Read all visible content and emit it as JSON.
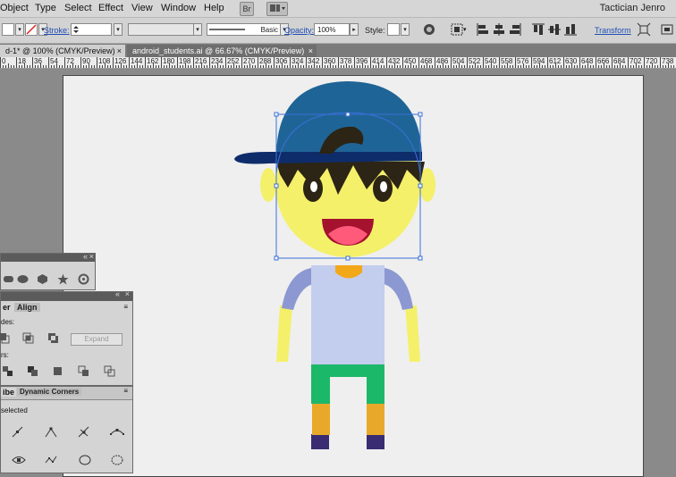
{
  "menubar": {
    "items": [
      "Object",
      "Type",
      "Select",
      "Effect",
      "View",
      "Window",
      "Help"
    ],
    "bridge_label": "Br",
    "user": "Tactician Jenro"
  },
  "controlbar": {
    "stroke_label": "Stroke:",
    "brush_style": "Basic",
    "opacity_label": "Opacity:",
    "opacity_value": "100%",
    "style_label": "Style:",
    "transform_label": "Transform"
  },
  "tabs": [
    {
      "label": "d-1* @ 100% (CMYK/Preview)",
      "active": true
    },
    {
      "label": "android_students.ai @ 66.67% (CMYK/Preview)",
      "active": false
    }
  ],
  "tab_close_glyph": "×",
  "ruler": {
    "labels": [
      "0",
      "18",
      "36",
      "54",
      "72",
      "90",
      "108",
      "126",
      "144",
      "162",
      "180",
      "198",
      "216",
      "234",
      "252",
      "270",
      "288",
      "306",
      "324",
      "342",
      "360",
      "378",
      "396",
      "414",
      "432",
      "450",
      "468",
      "486",
      "504",
      "522",
      "540",
      "558",
      "576",
      "594",
      "612",
      "630",
      "648",
      "666",
      "684",
      "702",
      "720",
      "738"
    ]
  },
  "pathfinder_panel": {
    "tabs": [
      "er",
      "Align"
    ],
    "shape_modes_label": "des:",
    "expand_label": "Expand",
    "pathfinders_label": "rs:"
  },
  "corner_panel": {
    "tabs": [
      "ibe",
      "Dynamic Corners"
    ],
    "selected_label": "selected"
  },
  "colors": {
    "cap": "#1f6496",
    "visor": "#0f2c6a",
    "hair": "#2c2414",
    "skin": "#f4f06a",
    "mouth": "#a4122e",
    "tongue": "#ff5a7a",
    "neck": "#f2a818",
    "shirt": "#c3cdee",
    "sleeve": "#8c98d2",
    "pants": "#1cb86a",
    "sock": "#e8a92a",
    "shoe": "#3a2c72",
    "selection": "#3a6fd8"
  }
}
